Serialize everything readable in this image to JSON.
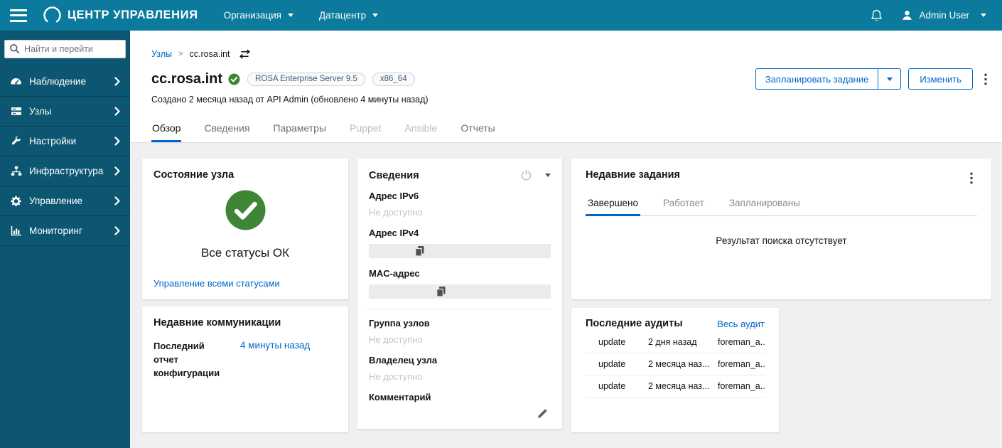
{
  "masthead": {
    "brand": "ЦЕНТР УПРАВЛЕНИЯ",
    "org_menu": "Организация",
    "dc_menu": "Датацентр",
    "user": "Admin User"
  },
  "sidebar": {
    "search_placeholder": "Найти и перейти",
    "items": [
      {
        "label": "Наблюдение",
        "icon": "gauge-icon"
      },
      {
        "label": "Узлы",
        "icon": "server-icon"
      },
      {
        "label": "Настройки",
        "icon": "wrench-icon"
      },
      {
        "label": "Инфраструктура",
        "icon": "sitemap-icon"
      },
      {
        "label": "Управление",
        "icon": "gear-icon"
      },
      {
        "label": "Мониторинг",
        "icon": "bar-chart-icon"
      }
    ]
  },
  "breadcrumb": {
    "parent": "Узлы",
    "separator": ">",
    "current": "cc.rosa.int"
  },
  "host": {
    "name": "cc.rosa.int",
    "os_badge": "ROSA Enterprise Server 9.5",
    "arch_badge": "x86_64",
    "created_note": "Создано 2 месяца назад от API Admin (обновлено 4 минуты назад)"
  },
  "actions": {
    "schedule_job": "Запланировать задание",
    "edit": "Изменить"
  },
  "tabs": [
    {
      "label": "Обзор"
    },
    {
      "label": "Сведения"
    },
    {
      "label": "Параметры"
    },
    {
      "label": "Puppet"
    },
    {
      "label": "Ansible"
    },
    {
      "label": "Отчеты"
    }
  ],
  "cards": {
    "status": {
      "title": "Состояние узла",
      "status_text": "Все статусы ОК",
      "manage_link": "Управление всеми статусами"
    },
    "communications": {
      "title": "Недавние коммуникации",
      "row_label": "Последний отчет конфигурации",
      "row_value": "4 минуты назад"
    },
    "details": {
      "title": "Сведения",
      "fields": [
        {
          "label": "Адрес IPv6",
          "value": "Не доступно"
        },
        {
          "label": "Адрес IPv4",
          "value": ""
        },
        {
          "label": "MAC-адрес",
          "value": ""
        },
        {
          "label": "Группа узлов",
          "value": "Не доступно"
        },
        {
          "label": "Владелец узла",
          "value": "Не доступно"
        },
        {
          "label": "Комментарий",
          "value": ""
        }
      ]
    },
    "jobs": {
      "title": "Недавние задания",
      "tabs": [
        {
          "label": "Завершено"
        },
        {
          "label": "Работает"
        },
        {
          "label": "Запланированы"
        }
      ],
      "empty_text": "Результат поиска отсутствует"
    },
    "audits": {
      "title": "Последние аудиты",
      "link": "Весь аудит",
      "rows": [
        {
          "action": "update",
          "time": "2 дня назад",
          "user": "foreman_a..."
        },
        {
          "action": "update",
          "time": "2 месяца наз...",
          "user": "foreman_a..."
        },
        {
          "action": "update",
          "time": "2 месяца наз...",
          "user": "foreman_a..."
        }
      ]
    }
  },
  "colors": {
    "accent": "#0066cc",
    "success": "#3e8635",
    "masthead_teal": "#0b7a9c",
    "masthead_navy": "#0d3150",
    "sidebar": "#0d5671",
    "content_bg": "#f0f0f0"
  }
}
